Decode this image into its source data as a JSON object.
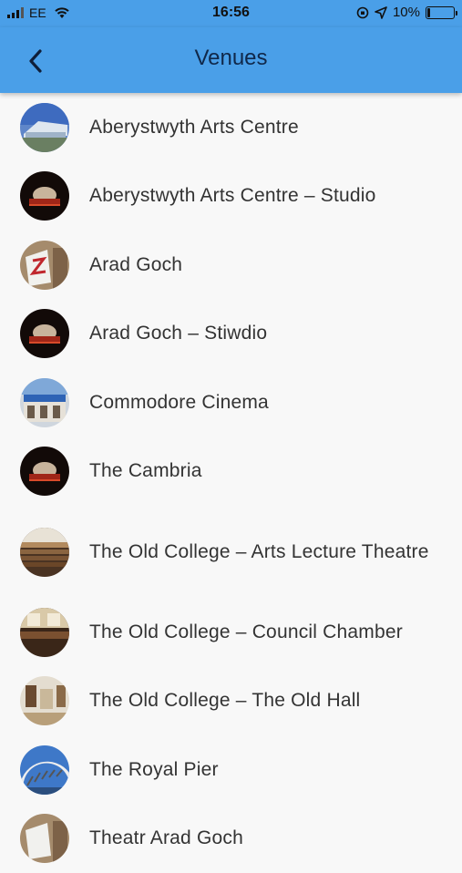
{
  "status_bar": {
    "carrier": "EE",
    "time": "16:56",
    "battery_percent": "10%",
    "battery_level": 0.1
  },
  "app_bar": {
    "title": "Venues",
    "back_icon": "chevron-left-icon"
  },
  "venues": [
    {
      "name": "Aberystwyth Arts Centre",
      "thumb": "building-photo"
    },
    {
      "name": "Aberystwyth Arts Centre – Studio",
      "thumb": "theatre-stage-photo"
    },
    {
      "name": "Arad Goch",
      "thumb": "sign-photo"
    },
    {
      "name": "Arad Goch – Stiwdio",
      "thumb": "theatre-stage-photo"
    },
    {
      "name": "Commodore Cinema",
      "thumb": "cinema-facade-photo"
    },
    {
      "name": "The Cambria",
      "thumb": "theatre-stage-photo"
    },
    {
      "name": "The Old College – Arts Lecture Theatre",
      "thumb": "lecture-theatre-photo"
    },
    {
      "name": "The Old College – Council Chamber",
      "thumb": "chamber-photo"
    },
    {
      "name": "The Old College – The Old Hall",
      "thumb": "hall-photo"
    },
    {
      "name": "The Royal Pier",
      "thumb": "pier-photo"
    },
    {
      "name": "Theatr Arad Goch",
      "thumb": "sign-photo"
    }
  ]
}
